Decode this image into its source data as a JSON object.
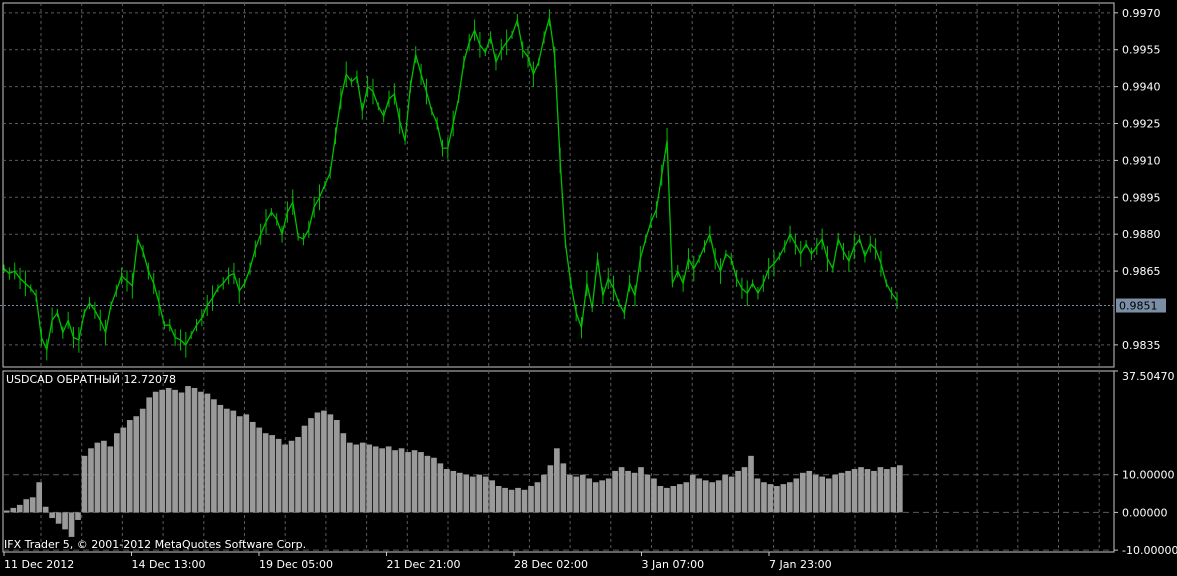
{
  "chart_data": [
    {
      "type": "line",
      "symbol_price_label": "0.9851",
      "current_price": 0.9851,
      "yticks": [
        "0.9970",
        "0.9955",
        "0.9940",
        "0.9925",
        "0.9910",
        "0.9895",
        "0.9880",
        "0.9865",
        "0.9835"
      ],
      "ylim": [
        0.9826,
        0.9974
      ],
      "series_color": "#00c000",
      "series": [
        {
          "values": [
            0.9866,
            0.9864,
            0.9865,
            0.9862,
            0.986,
            0.9858,
            0.9855,
            0.9838,
            0.9833,
            0.9845,
            0.9848,
            0.984,
            0.9845,
            0.9838,
            0.9837,
            0.9848,
            0.9852,
            0.9849,
            0.9845,
            0.984,
            0.9851,
            0.9857,
            0.9863,
            0.9861,
            0.9859,
            0.9878,
            0.9873,
            0.9865,
            0.986,
            0.9852,
            0.9843,
            0.9843,
            0.9838,
            0.9837,
            0.9835,
            0.9839,
            0.9843,
            0.9846,
            0.9851,
            0.9854,
            0.9858,
            0.986,
            0.9863,
            0.9864,
            0.9857,
            0.986,
            0.9866,
            0.9874,
            0.988,
            0.9885,
            0.9889,
            0.9886,
            0.988,
            0.9889,
            0.9893,
            0.9879,
            0.9878,
            0.9882,
            0.9891,
            0.9895,
            0.99,
            0.9905,
            0.992,
            0.9935,
            0.9945,
            0.9942,
            0.9944,
            0.993,
            0.994,
            0.9938,
            0.9932,
            0.9928,
            0.9935,
            0.9937,
            0.9926,
            0.9918,
            0.994,
            0.9953,
            0.9945,
            0.9938,
            0.993,
            0.9925,
            0.9915,
            0.9915,
            0.9925,
            0.9935,
            0.995,
            0.9958,
            0.9963,
            0.9957,
            0.9954,
            0.996,
            0.995,
            0.9955,
            0.9958,
            0.9961,
            0.9967,
            0.9955,
            0.9952,
            0.9945,
            0.995,
            0.996,
            0.9968,
            0.9952,
            0.991,
            0.9876,
            0.986,
            0.9848,
            0.9842,
            0.986,
            0.985,
            0.987,
            0.9855,
            0.9862,
            0.9858,
            0.9852,
            0.9848,
            0.986,
            0.9855,
            0.987,
            0.9878,
            0.9885,
            0.989,
            0.9904,
            0.9918,
            0.986,
            0.9865,
            0.986,
            0.987,
            0.9866,
            0.987,
            0.9875,
            0.988,
            0.987,
            0.9865,
            0.9872,
            0.987,
            0.9862,
            0.9858,
            0.9856,
            0.986,
            0.9856,
            0.986,
            0.9866,
            0.9868,
            0.9871,
            0.9875,
            0.988,
            0.9876,
            0.9872,
            0.9876,
            0.9872,
            0.9875,
            0.9878,
            0.987,
            0.9866,
            0.9878,
            0.9873,
            0.9869,
            0.9875,
            0.9878,
            0.9871,
            0.9876,
            0.9874,
            0.9868,
            0.986,
            0.9856,
            0.9853
          ]
        }
      ]
    },
    {
      "type": "bar",
      "indicator_label": "USDCAD ОБРАТНЫЙ 12.72078",
      "yticks": [
        "37.50470",
        "10.00000",
        "0.00000",
        "-10.00000"
      ],
      "ylim": [
        -10.5,
        37.5
      ],
      "bar_color": "#9a9a9a",
      "values": [
        0.5,
        1.2,
        2.0,
        3.5,
        4.0,
        8.0,
        1.5,
        -1.5,
        -3.0,
        -4.5,
        -6.5,
        -2.0,
        15.0,
        17.0,
        18.5,
        19.0,
        17.5,
        21.0,
        22.5,
        24.5,
        25.5,
        27.5,
        30.5,
        32.0,
        32.5,
        33.0,
        32.5,
        31.8,
        33.5,
        33.0,
        32.0,
        31.5,
        30.0,
        28.5,
        27.5,
        27.0,
        25.5,
        26.0,
        24.0,
        22.5,
        21.0,
        20.5,
        19.5,
        18.0,
        19.0,
        20.0,
        23.0,
        25.0,
        26.5,
        27.0,
        26.0,
        24.5,
        21.0,
        18.5,
        18.0,
        18.5,
        18.0,
        17.5,
        17.0,
        17.5,
        16.5,
        17.0,
        16.0,
        16.5,
        16.0,
        15.0,
        14.5,
        13.0,
        11.5,
        11.0,
        10.5,
        10.0,
        9.5,
        10.0,
        9.5,
        8.5,
        7.0,
        6.5,
        6.0,
        6.5,
        6.0,
        7.0,
        8.0,
        10.0,
        12.5,
        17.0,
        13.0,
        10.0,
        9.5,
        10.0,
        9.0,
        8.0,
        8.5,
        9.0,
        11.0,
        12.0,
        11.0,
        10.5,
        12.0,
        10.0,
        9.0,
        7.0,
        6.5,
        7.0,
        7.5,
        8.0,
        10.0,
        9.0,
        8.5,
        8.0,
        8.5,
        10.0,
        9.5,
        11.0,
        12.0,
        15.0,
        9.0,
        8.0,
        7.5,
        7.0,
        7.5,
        8.0,
        9.0,
        10.5,
        11.0,
        10.0,
        9.5,
        9.0,
        10.0,
        10.5,
        11.0,
        11.5,
        12.0,
        11.5,
        11.0,
        12.0,
        11.5,
        12.0,
        12.5
      ]
    }
  ],
  "x_axis": {
    "labels": [
      "11 Dec 2012",
      "14 Dec 13:00",
      "19 Dec 05:00",
      "21 Dec 21:00",
      "28 Dec 02:00",
      "3 Jan 07:00",
      "7 Jan 23:00"
    ]
  },
  "footer": {
    "copyright": "IFX Trader 5, © 2001-2012 MetaQuotes Software Corp."
  }
}
